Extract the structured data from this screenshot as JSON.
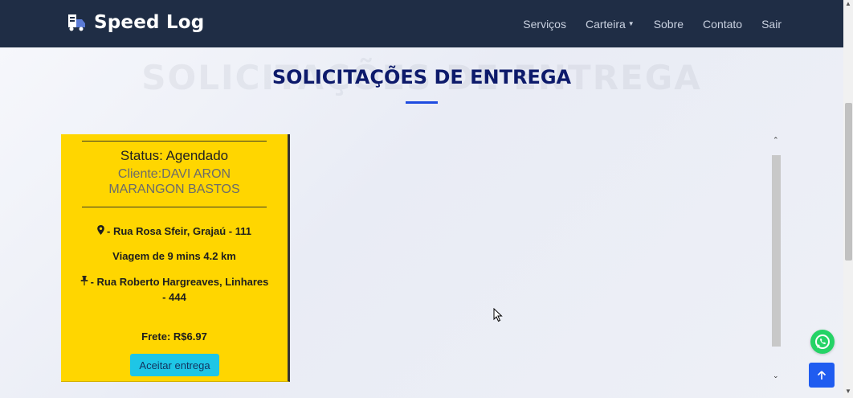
{
  "header": {
    "brand": "Speed Log",
    "nav": [
      {
        "label": "Serviços",
        "has_caret": false
      },
      {
        "label": "Carteira",
        "has_caret": true
      },
      {
        "label": "Sobre",
        "has_caret": false
      },
      {
        "label": "Contato",
        "has_caret": false
      },
      {
        "label": "Sair",
        "has_caret": false
      }
    ]
  },
  "main": {
    "title": "SOLICITAÇÕES DE ENTREGA",
    "background_title": "SOLICITAÇÕES DE ENTREGA"
  },
  "card": {
    "status": "Status: Agendado",
    "client": "Cliente:DAVI ARON MARANGON BASTOS",
    "origin": "- Rua Rosa Sfeir, Grajaú - 111",
    "trip": "Viagem de 9 mins 4.2 km",
    "destination": "- Rua Roberto Hargreaves, Linhares - 444",
    "fare": "Frete: R$6.97",
    "accept_button": "Aceitar entrega"
  },
  "icons": {
    "origin": "map-marker-icon",
    "destination": "pushpin-icon",
    "whatsapp": "whatsapp-icon",
    "back_to_top": "arrow-up-icon"
  },
  "colors": {
    "navbar": "#1f2d45",
    "card": "#ffd600",
    "title": "#0d1a6b",
    "accent": "#1e4be0",
    "button": "#1ec6e6",
    "whatsapp": "#25d366",
    "to_top": "#1f5cf0"
  }
}
